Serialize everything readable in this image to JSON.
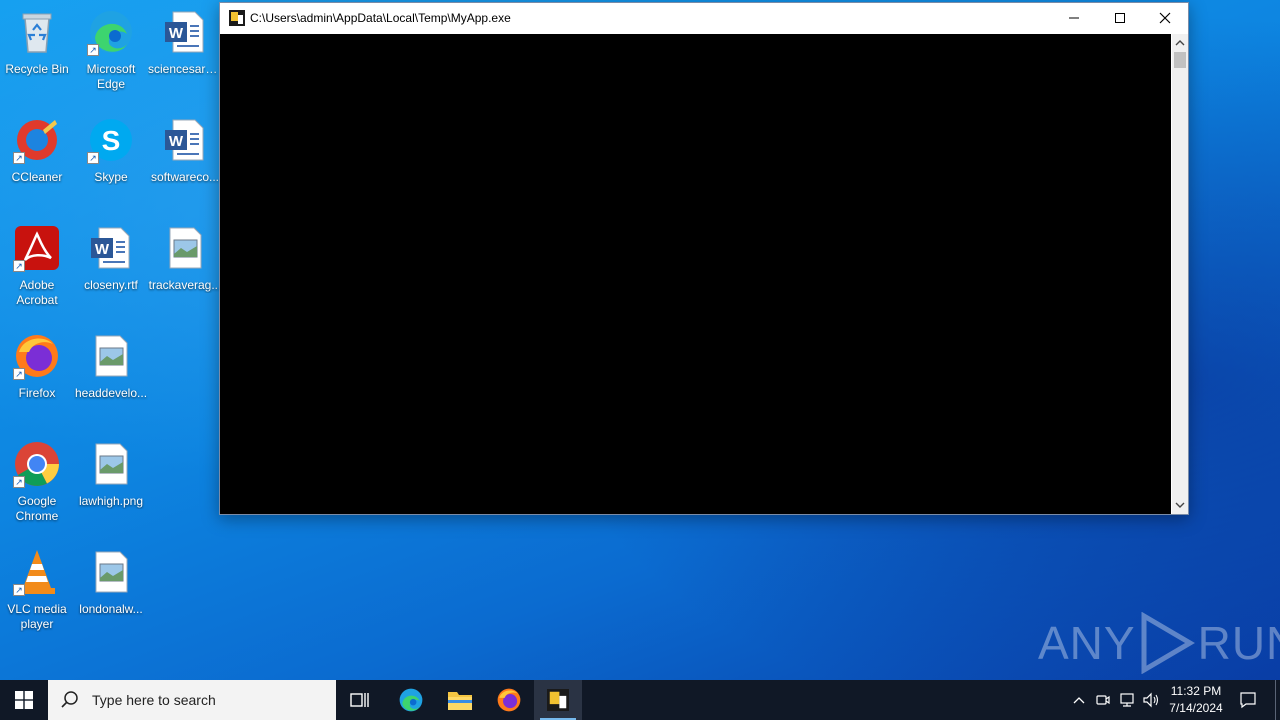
{
  "desktop": {
    "icons": [
      {
        "label": "Recycle Bin",
        "icon": "recycle-bin-icon"
      },
      {
        "label": "Microsoft Edge",
        "icon": "edge-icon"
      },
      {
        "label": "sciencesare...",
        "icon": "word-doc-icon"
      },
      {
        "label": "CCleaner",
        "icon": "ccleaner-icon"
      },
      {
        "label": "Skype",
        "icon": "skype-icon"
      },
      {
        "label": "softwareco...",
        "icon": "word-doc-icon"
      },
      {
        "label": "Adobe Acrobat",
        "icon": "acrobat-icon"
      },
      {
        "label": "closeny.rtf",
        "icon": "word-doc-icon"
      },
      {
        "label": "trackaverag...",
        "icon": "image-file-icon"
      },
      {
        "label": "Firefox",
        "icon": "firefox-icon"
      },
      {
        "label": "headdevelo...",
        "icon": "image-file-icon"
      },
      {
        "label": "Google Chrome",
        "icon": "chrome-icon"
      },
      {
        "label": "lawhigh.png",
        "icon": "image-file-icon"
      },
      {
        "label": "VLC media player",
        "icon": "vlc-icon"
      },
      {
        "label": "londonalw...",
        "icon": "image-file-icon"
      }
    ]
  },
  "window": {
    "title": "C:\\Users\\admin\\AppData\\Local\\Temp\\MyApp.exe",
    "console_bg": "#000000"
  },
  "taskbar": {
    "search_placeholder": "Type here to search",
    "time": "11:32 PM",
    "date": "7/14/2024",
    "bg": "#101826"
  },
  "watermark": {
    "text_left": "ANY",
    "text_right": "RUN"
  }
}
